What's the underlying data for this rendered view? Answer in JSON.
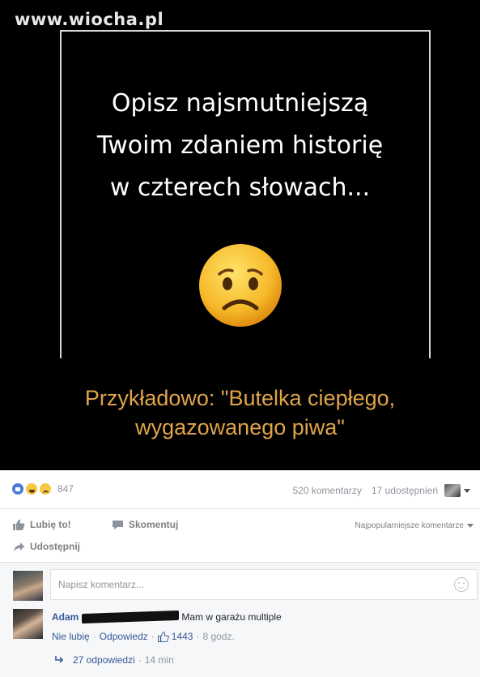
{
  "meme": {
    "watermark": "www.wiocha.pl",
    "question": "Opisz najsmutniejszą\nTwoim zdaniem historię\nw czterech słowach...",
    "example": "Przykładowo: \"Butelka ciepłego,\nwygazowanego piwa\"",
    "emoji": "sad-face-emoji"
  },
  "post": {
    "reaction_count": "847",
    "comments_count": "520 komentarzy",
    "shares_count": "17 udostępnień",
    "actions": {
      "like": "Lubię to!",
      "comment": "Skomentuj",
      "share": "Udostępnij"
    },
    "sort_label": "Najpopularniejsze komentarze"
  },
  "composer": {
    "placeholder": "Napisz komentarz..."
  },
  "comment": {
    "author": "Adam",
    "text": "Mam w garażu multiple",
    "unlike": "Nie lubię",
    "reply": "Odpowiedz",
    "likes": "1443",
    "time": "8 godz.",
    "replies_label": "27 odpowiedzi",
    "replies_time": "14 min"
  },
  "colors": {
    "link": "#365899",
    "example_text": "#e0a44a",
    "meta": "#90949c"
  }
}
